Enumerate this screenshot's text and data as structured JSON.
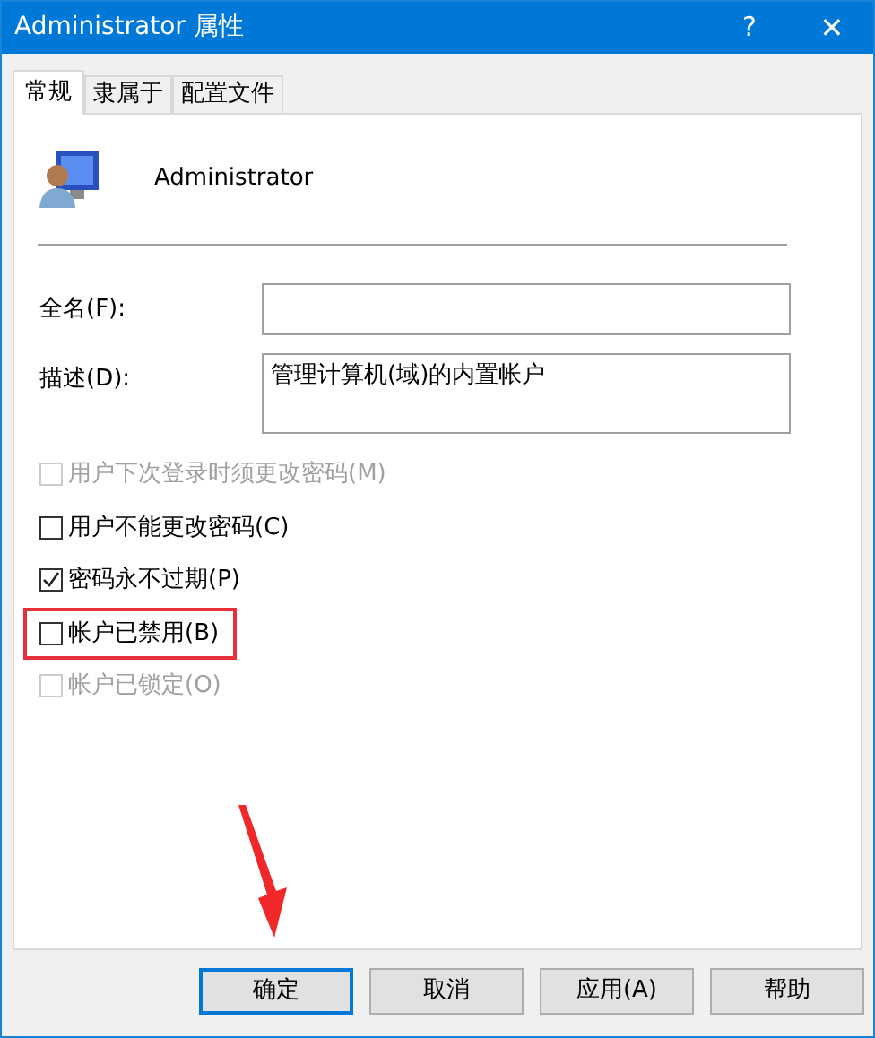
{
  "window": {
    "title": "Administrator 属性",
    "help": "?",
    "close": "✕"
  },
  "tabs": [
    {
      "label": "常规",
      "selected": true
    },
    {
      "label": "隶属于",
      "selected": false
    },
    {
      "label": "配置文件",
      "selected": false
    }
  ],
  "user": {
    "name": "Administrator"
  },
  "fields": [
    {
      "label": "全名(F):",
      "multiline": false
    },
    {
      "label": "描述(D):",
      "value": "管理计算机(域)的内置帐户",
      "multiline": true
    }
  ],
  "checkboxes": [
    {
      "label": "用户下次登录时须更改密码(M)",
      "checked": false,
      "disabled": true,
      "highlighted": false
    },
    {
      "label": "用户不能更改密码(C)",
      "checked": false,
      "disabled": false,
      "highlighted": false
    },
    {
      "label": "密码永不过期(P)",
      "checked": true,
      "disabled": false,
      "highlighted": false
    },
    {
      "label": "帐户已禁用(B)",
      "checked": false,
      "disabled": false,
      "highlighted": true
    },
    {
      "label": "帐户已锁定(O)",
      "checked": false,
      "disabled": true,
      "highlighted": false
    }
  ],
  "buttons": [
    {
      "label": "确定",
      "default": true,
      "pointed": true
    },
    {
      "label": "取消",
      "default": false,
      "pointed": false
    },
    {
      "label": "应用(A)",
      "default": false,
      "pointed": false
    },
    {
      "label": "帮助",
      "default": false,
      "pointed": false
    }
  ]
}
